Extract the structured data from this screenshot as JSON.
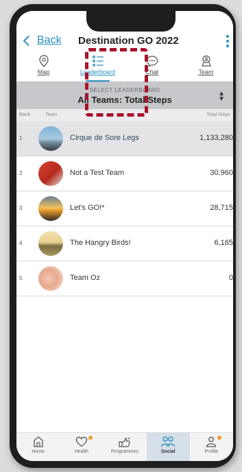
{
  "header": {
    "back_label": "Back",
    "title": "Destination GO 2022"
  },
  "tabs": [
    {
      "label": "Map",
      "icon": "map-pin-icon"
    },
    {
      "label": "Leaderboard",
      "icon": "list-icon",
      "active": true
    },
    {
      "label": "Chat",
      "icon": "chat-bubble-icon"
    },
    {
      "label": "Team",
      "icon": "team-badge-icon"
    }
  ],
  "leaderboard_select": {
    "label": "SELECT LEADERBOARD",
    "value": "All Teams: Total Steps"
  },
  "columns": {
    "rank": "Rank",
    "team": "Team",
    "steps": "Total Steps"
  },
  "rows": [
    {
      "rank": "1",
      "name": "Cirque de Sore Legs",
      "steps": "1,133,280"
    },
    {
      "rank": "2",
      "name": "Not a Test Team",
      "steps": "30,960"
    },
    {
      "rank": "3",
      "name": "Let's GO!*",
      "steps": "28,715"
    },
    {
      "rank": "4",
      "name": "The Hangry Birds!",
      "steps": "6,165"
    },
    {
      "rank": "5",
      "name": "Team Oz",
      "steps": "0"
    }
  ],
  "bottom_nav": [
    {
      "label": "Home",
      "icon": "home-icon"
    },
    {
      "label": "Health",
      "icon": "heart-icon",
      "badge": true
    },
    {
      "label": "Programmes",
      "icon": "programmes-icon"
    },
    {
      "label": "Social",
      "icon": "people-icon",
      "active": true
    },
    {
      "label": "Profile",
      "icon": "profile-icon",
      "badge": true
    }
  ],
  "colors": {
    "accent": "#2a8fbf",
    "highlight": "#a8122a",
    "badge": "#f0a030"
  }
}
